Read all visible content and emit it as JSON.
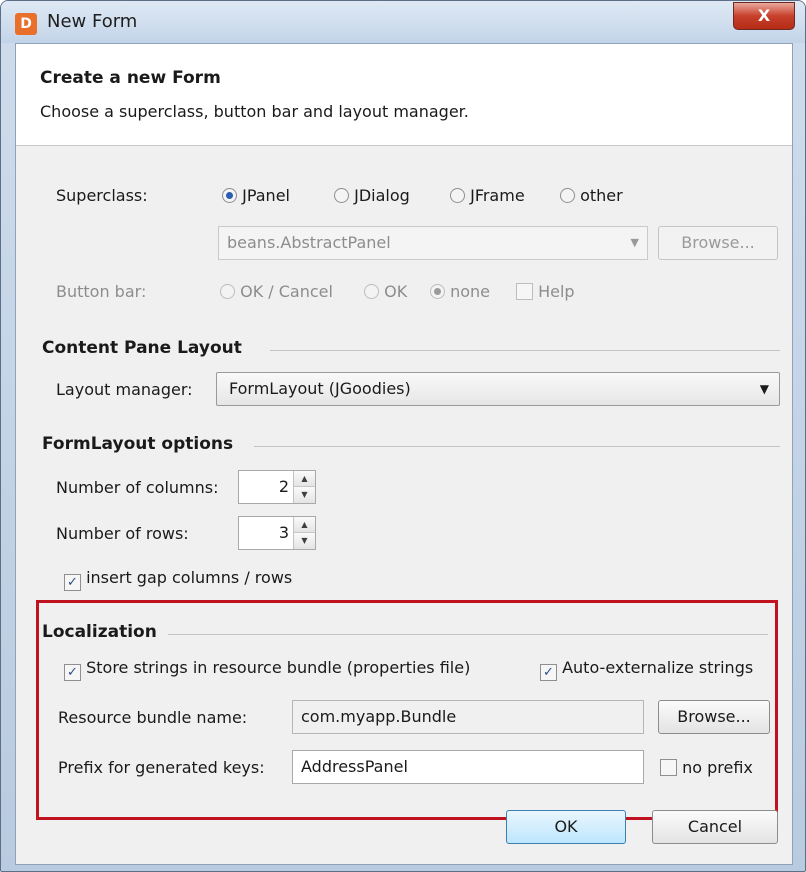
{
  "window": {
    "title": "New Form",
    "app_icon": "formdev-icon",
    "close_glyph": "X"
  },
  "header": {
    "title": "Create a new Form",
    "description": "Choose a superclass, button bar and layout manager."
  },
  "superclass": {
    "label": "Superclass:",
    "options": [
      "JPanel",
      "JDialog",
      "JFrame",
      "other"
    ],
    "selected": "JPanel",
    "class_field_value": "beans.AbstractPanel",
    "browse_label": "Browse..."
  },
  "button_bar": {
    "label": "Button bar:",
    "options": [
      "OK / Cancel",
      "OK",
      "none"
    ],
    "selected": "none",
    "help_label": "Help",
    "help_checked": false
  },
  "content_pane": {
    "section_title": "Content Pane Layout",
    "layout_label": "Layout manager:",
    "layout_value": "FormLayout (JGoodies)"
  },
  "formlayout": {
    "section_title": "FormLayout options",
    "columns_label": "Number of columns:",
    "columns_value": "2",
    "rows_label": "Number of rows:",
    "rows_value": "3",
    "gap_label": "insert gap columns / rows",
    "gap_checked": true
  },
  "localization": {
    "section_title": "Localization",
    "store_label": "Store strings in resource bundle (properties file)",
    "store_checked": true,
    "auto_label": "Auto-externalize strings",
    "auto_checked": true,
    "bundle_label": "Resource bundle name:",
    "bundle_value": "com.myapp.Bundle",
    "browse_label": "Browse...",
    "prefix_label": "Prefix for generated keys:",
    "prefix_value": "AddressPanel",
    "no_prefix_label": "no prefix",
    "no_prefix_checked": false
  },
  "footer": {
    "ok_label": "OK",
    "cancel_label": "Cancel"
  },
  "colors": {
    "highlight": "#c0131f",
    "default_button": "#3c7fb1"
  }
}
